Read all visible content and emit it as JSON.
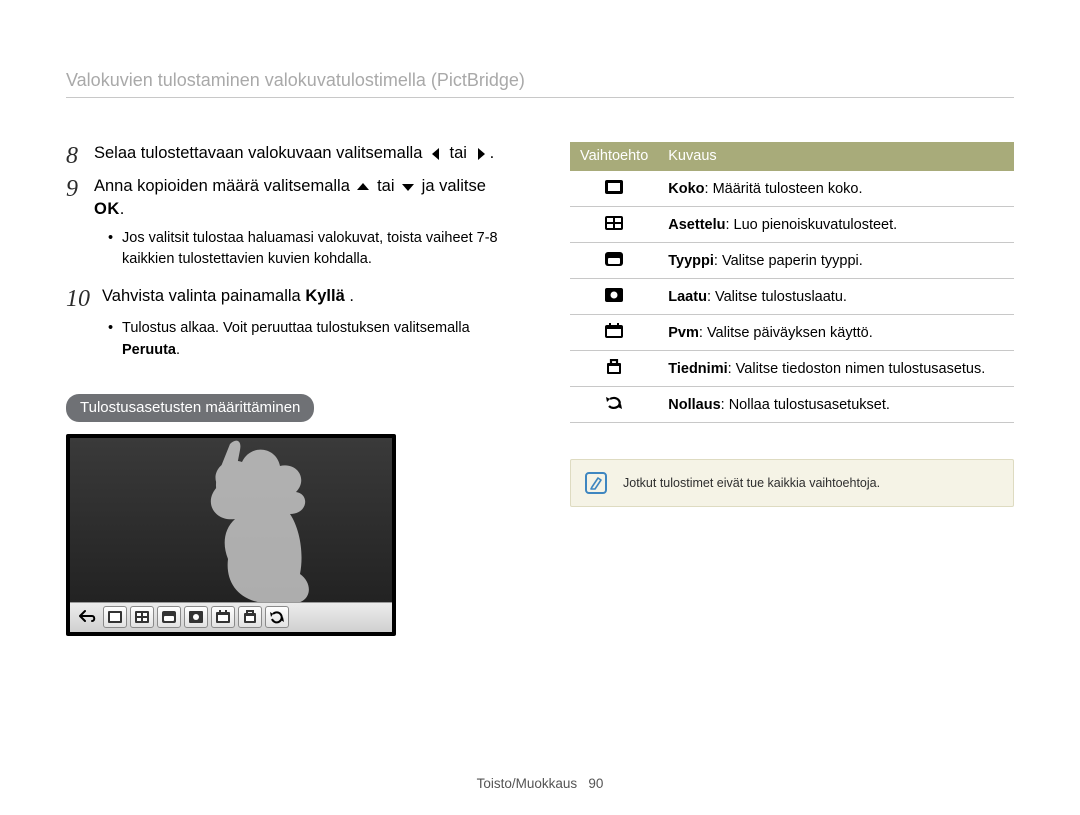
{
  "header": {
    "title": "Valokuvien tulostaminen valokuvatulostimella (PictBridge)"
  },
  "steps": {
    "s8": {
      "num": "8",
      "pre": "Selaa tulostettavaan valokuvaan valitsemalla ",
      "mid": " tai ",
      "post": "."
    },
    "s9": {
      "num": "9",
      "pre": "Anna kopioiden määrä valitsemalla ",
      "mid": " tai ",
      "post": " ja valitse ",
      "ok": "OK",
      "end": "."
    },
    "s9_bullet": "Jos valitsit tulostaa haluamasi valokuvat, toista vaiheet 7-8 kaikkien tulostettavien kuvien kohdalla.",
    "s10": {
      "num": "10",
      "pre": "Vahvista valinta painamalla ",
      "bold": "Kyllä",
      "post": " ."
    },
    "s10_bullet_pre": "Tulostus alkaa. Voit peruuttaa tulostuksen valitsemalla ",
    "s10_bullet_bold": "Peruuta",
    "s10_bullet_post": "."
  },
  "pill": "Tulostusasetusten määrittäminen",
  "table": {
    "head": {
      "c1": "Vaihtoehto",
      "c2": "Kuvaus"
    },
    "rows": [
      {
        "icon": "size",
        "b": "Koko",
        "d": ": Määritä tulosteen koko."
      },
      {
        "icon": "layout",
        "b": "Asettelu",
        "d": ": Luo pienoiskuvatulosteet."
      },
      {
        "icon": "type",
        "b": "Tyyppi",
        "d": ": Valitse paperin tyyppi."
      },
      {
        "icon": "quality",
        "b": "Laatu",
        "d": ": Valitse tulostuslaatu."
      },
      {
        "icon": "date",
        "b": "Pvm",
        "d": ": Valitse päiväyksen käyttö."
      },
      {
        "icon": "file",
        "b": "Tiednimi",
        "d": ": Valitse tiedoston nimen tulostusasetus."
      },
      {
        "icon": "reset",
        "b": "Nollaus",
        "d": ": Nollaa tulostusasetukset."
      }
    ]
  },
  "note": "Jotkut tulostimet eivät tue kaikkia vaihtoehtoja.",
  "footer": {
    "section": "Toisto/Muokkaus",
    "page": "90"
  }
}
